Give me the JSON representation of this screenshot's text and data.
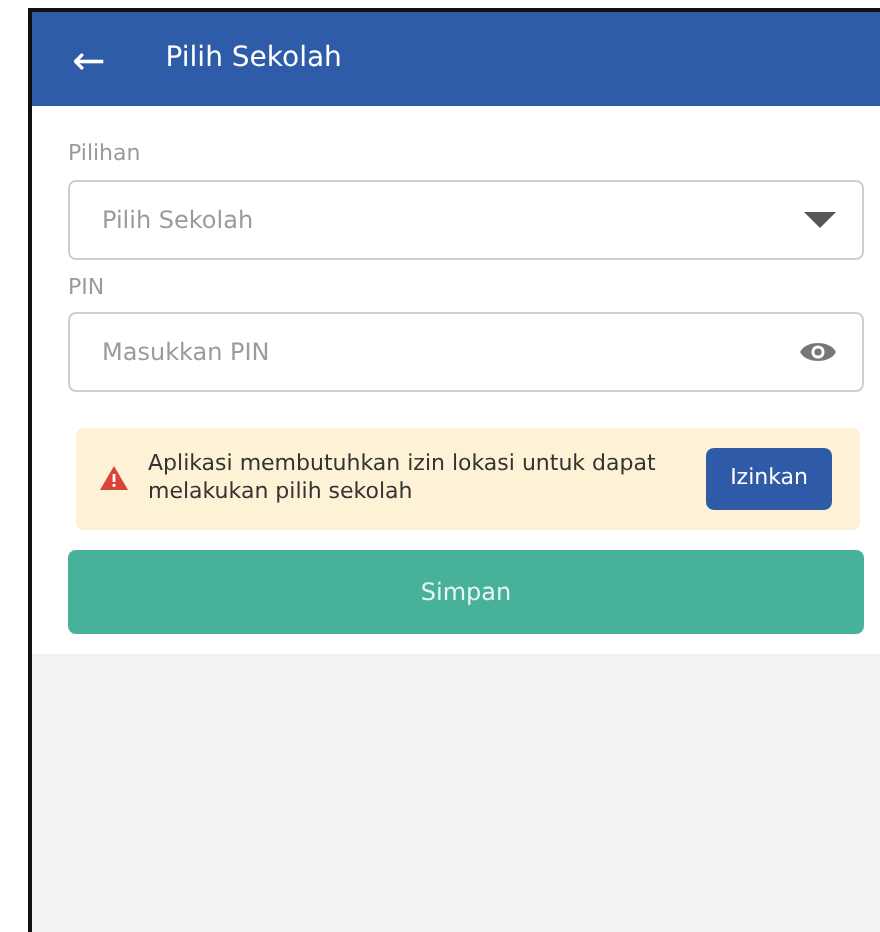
{
  "app_bar": {
    "back_icon": "←",
    "title": "Pilih Sekolah"
  },
  "fields": [
    {
      "kind": "select",
      "label": "Pilihan",
      "placeholder": "Pilih Sekolah"
    },
    {
      "kind": "password",
      "label": "PIN",
      "placeholder": "Masukkan PIN"
    }
  ],
  "alert": {
    "message": "Aplikasi membutuhkan izin lokasi untuk dapat melakukan pilih sekolah",
    "button": "Izinkan"
  },
  "save_button": "Simpan"
}
